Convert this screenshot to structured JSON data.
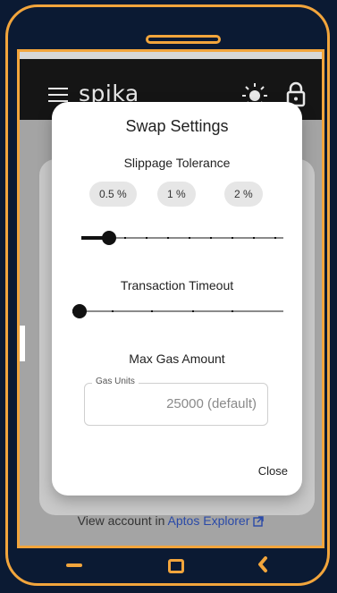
{
  "app": {
    "logo_text": "spika"
  },
  "dialog": {
    "title": "Swap Settings",
    "slippage_heading": "Slippage Tolerance",
    "slippage_chips": [
      "0.5 %",
      "1 %",
      "2 %"
    ],
    "slippage_slider_fraction": 0.1,
    "timeout_heading": "Transaction Timeout",
    "timeout_slider_fraction": 0.0,
    "gas_heading": "Max Gas Amount",
    "gas_field": {
      "label": "Gas Units",
      "value": "25000 (default)"
    },
    "close_label": "Close"
  },
  "footer": {
    "prefix": "View account in ",
    "link_label": "Aptos Explorer"
  },
  "colors": {
    "frame_accent": "#f2a53c",
    "background": "#0b1a33",
    "link": "#2a4aa8"
  },
  "icons": [
    "menu-icon",
    "sun-icon",
    "lock-icon",
    "external-link-icon",
    "home-icon",
    "back-icon"
  ]
}
